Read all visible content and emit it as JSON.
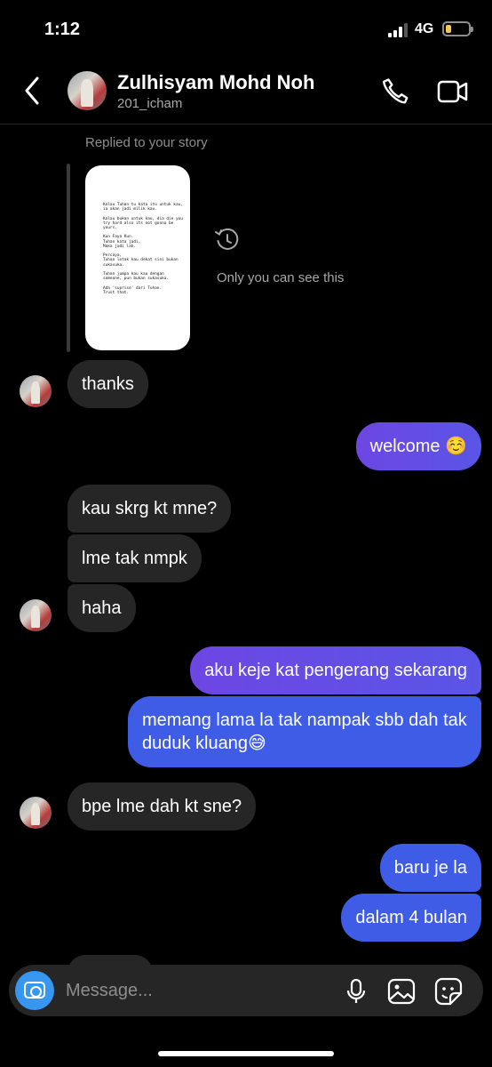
{
  "status_bar": {
    "time": "1:12",
    "network": "4G"
  },
  "header": {
    "name": "Zulhisyam Mohd Noh",
    "handle": "201_icham"
  },
  "story_reply": {
    "label": "Replied to your story",
    "story_text": "Kalau Tuhan tu kata itu untuk kau, ia akan jadi milik kau.\n\nKalau bukan untuk kau, dia die you try hard also its not gonna be yours.\n\nKun Faya Kun.\nTuhan kata jadi,\nMaka jadi lah.\n\nPercaya,\nTuhan letak kau dekat sini bukan sukasuka.\n\nTuhan jumpa kau kau dengan someone, pun bukan sukasuka.\n\nAda 'suprise' dari Tuhan.\nTrust that.",
    "visibility_note": "Only you can see this"
  },
  "messages": [
    {
      "text": "thanks"
    },
    {
      "text": "welcome ☺️"
    },
    {
      "text": "kau skrg kt mne?"
    },
    {
      "text": "lme tak nmpk"
    },
    {
      "text": "haha"
    },
    {
      "text": "aku keje kat pengerang sekarang"
    },
    {
      "text": "memang lama la tak nampak sbb dah tak duduk kluang😅"
    },
    {
      "text": "bpe lme dah kt sne?"
    },
    {
      "text": "baru je la"
    },
    {
      "text": "dalam 4 bulan"
    }
  ],
  "compose": {
    "placeholder": "Message..."
  },
  "colors": {
    "incoming": "#262626",
    "outgoing_purple": "#6d46e3",
    "outgoing_blue": "#3e5ce6",
    "camera": "#3797f0"
  },
  "icons": [
    "back-chevron-icon",
    "phone-icon",
    "video-camera-icon",
    "history-icon",
    "camera-icon",
    "microphone-icon",
    "gallery-icon",
    "sticker-icon"
  ]
}
